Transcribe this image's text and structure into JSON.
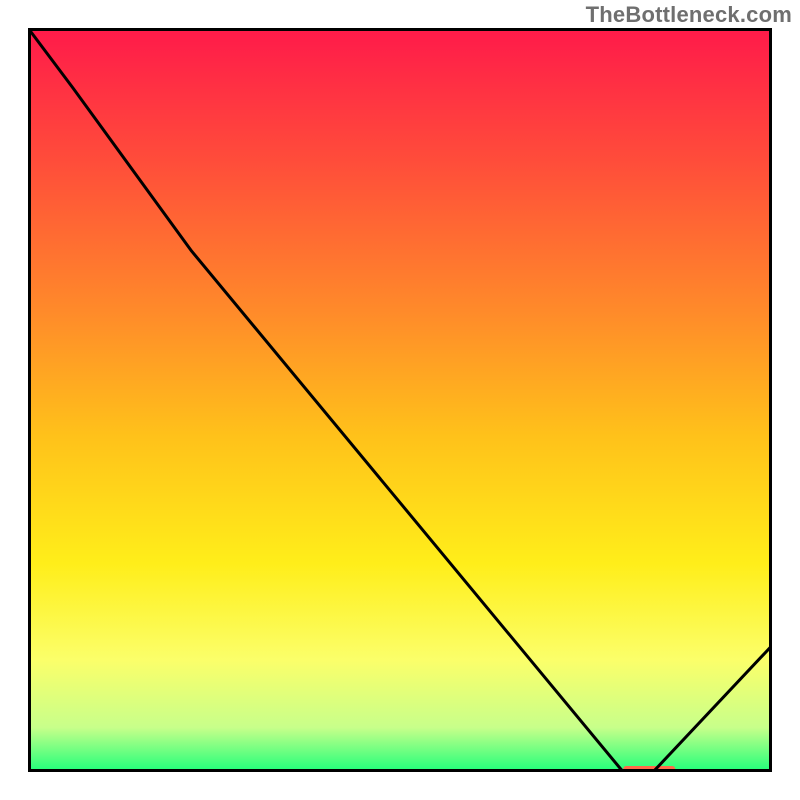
{
  "watermark": "TheBottleneck.com",
  "chart_data": {
    "type": "line",
    "title": "",
    "xlabel": "",
    "ylabel": "",
    "x": [
      0.0,
      0.06,
      0.22,
      0.8,
      0.84,
      1.0
    ],
    "values": [
      1.0,
      0.92,
      0.7,
      0.0,
      0.0,
      0.17
    ],
    "xlim": [
      0,
      1
    ],
    "ylim": [
      0,
      1
    ],
    "background_gradient": {
      "type": "vertical-rainbow",
      "stops": [
        {
          "pos": 0.0,
          "color": "#ff1a4a"
        },
        {
          "pos": 0.18,
          "color": "#ff4d3a"
        },
        {
          "pos": 0.38,
          "color": "#ff8a2a"
        },
        {
          "pos": 0.55,
          "color": "#ffc21a"
        },
        {
          "pos": 0.72,
          "color": "#ffee1a"
        },
        {
          "pos": 0.85,
          "color": "#fbff6a"
        },
        {
          "pos": 0.94,
          "color": "#c8ff8a"
        },
        {
          "pos": 1.0,
          "color": "#1eff7a"
        }
      ]
    },
    "marker": {
      "x_start": 0.8,
      "x_end": 0.87,
      "y": 0.0,
      "color": "#ff6a4a"
    },
    "line_color": "#000000",
    "frame_color": "#000000"
  }
}
